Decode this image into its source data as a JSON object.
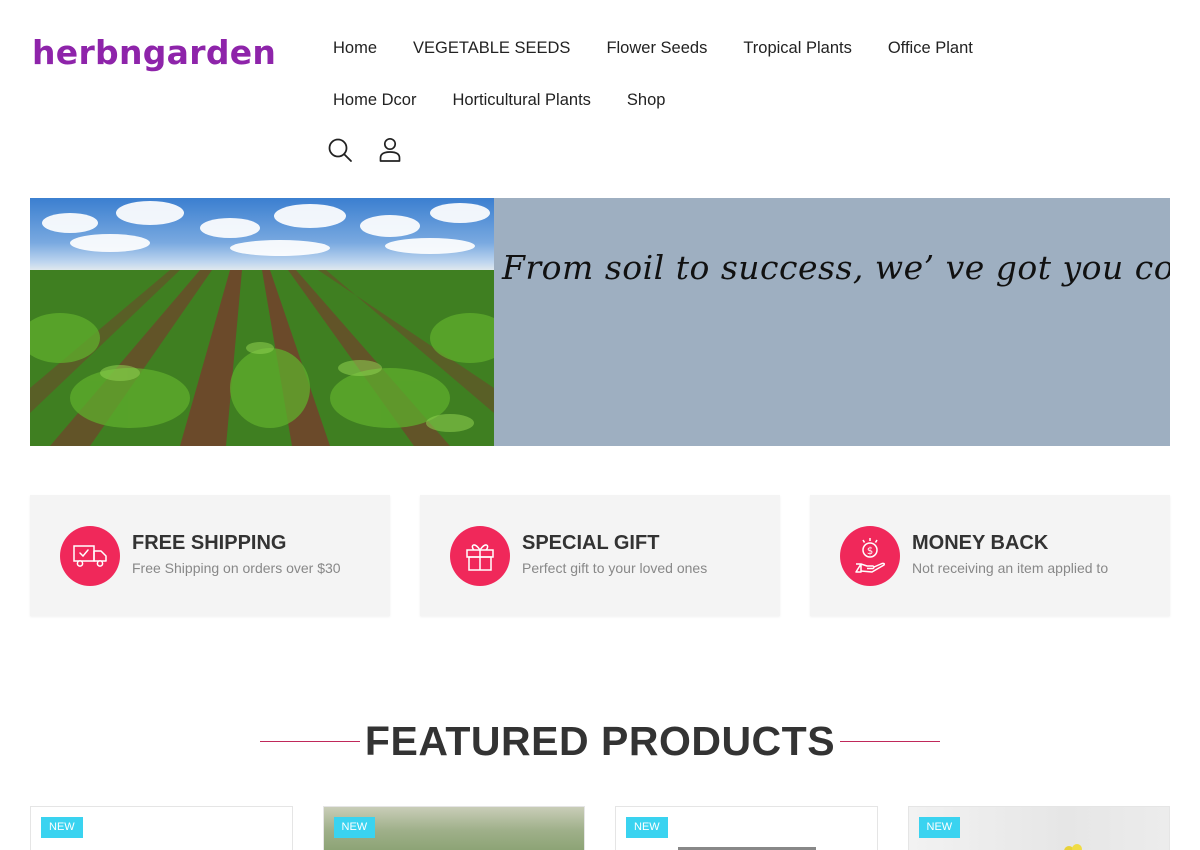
{
  "header": {
    "logo_text": "herbngarden",
    "nav": [
      "Home",
      "VEGETABLE SEEDS",
      "Flower Seeds",
      "Tropical Plants",
      "Office Plant",
      "Home Dcor",
      "Horticultural Plants",
      "Shop"
    ],
    "icons": [
      "search-icon",
      "user-icon"
    ]
  },
  "hero": {
    "tagline": "From soil to success, we’  ve got you covered",
    "banner_color": "#9eafc1"
  },
  "features": [
    {
      "title": "FREE SHIPPING",
      "desc": "Free Shipping on orders over $30",
      "icon": "truck-icon"
    },
    {
      "title": "SPECIAL GIFT",
      "desc": "Perfect gift to your loved ones",
      "icon": "gift-icon"
    },
    {
      "title": "MONEY BACK",
      "desc": "Not receiving an item applied to",
      "icon": "money-hand-icon"
    }
  ],
  "featured": {
    "title": "FEATURED PRODUCTS",
    "products": [
      {
        "badge": "NEW"
      },
      {
        "badge": "NEW"
      },
      {
        "badge": "NEW"
      },
      {
        "badge": "NEW"
      }
    ]
  },
  "colors": {
    "brand": "#8e24aa",
    "accent": "#f0285a",
    "badge": "#3ad3f0"
  }
}
